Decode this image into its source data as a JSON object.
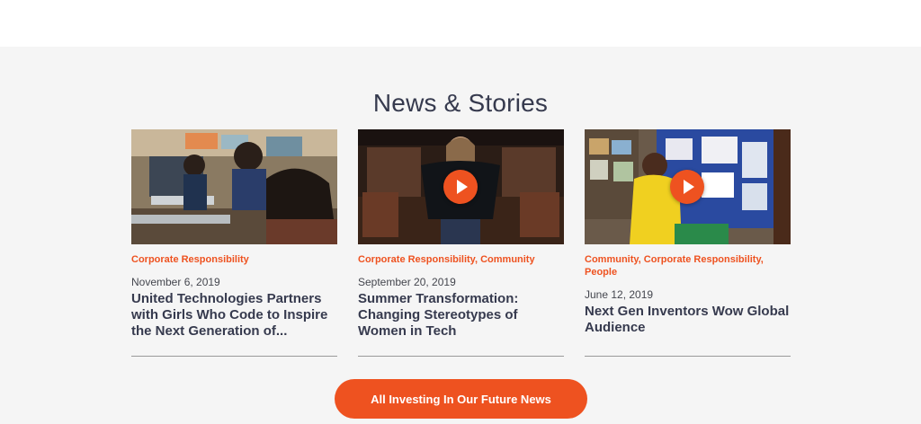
{
  "section": {
    "title": "News & Stories",
    "cta_label": "All Investing In Our Future News"
  },
  "colors": {
    "accent": "#ee5220",
    "heading": "#363a4e",
    "background": "#f5f5f5"
  },
  "cards": [
    {
      "tags": "Corporate Responsibility",
      "date": "November 6, 2019",
      "title": "United Technologies Partners with Girls Who Code to Inspire the Next Generation of...",
      "has_video": false
    },
    {
      "tags": "Corporate Responsibility, Community",
      "date": "September 20, 2019",
      "title": "Summer Transformation: Changing Stereotypes of Women in Tech",
      "has_video": true
    },
    {
      "tags": "Community, Corporate Responsibility, People",
      "date": "June 12, 2019",
      "title": "Next Gen Inventors Wow Global Audience",
      "has_video": true
    }
  ]
}
